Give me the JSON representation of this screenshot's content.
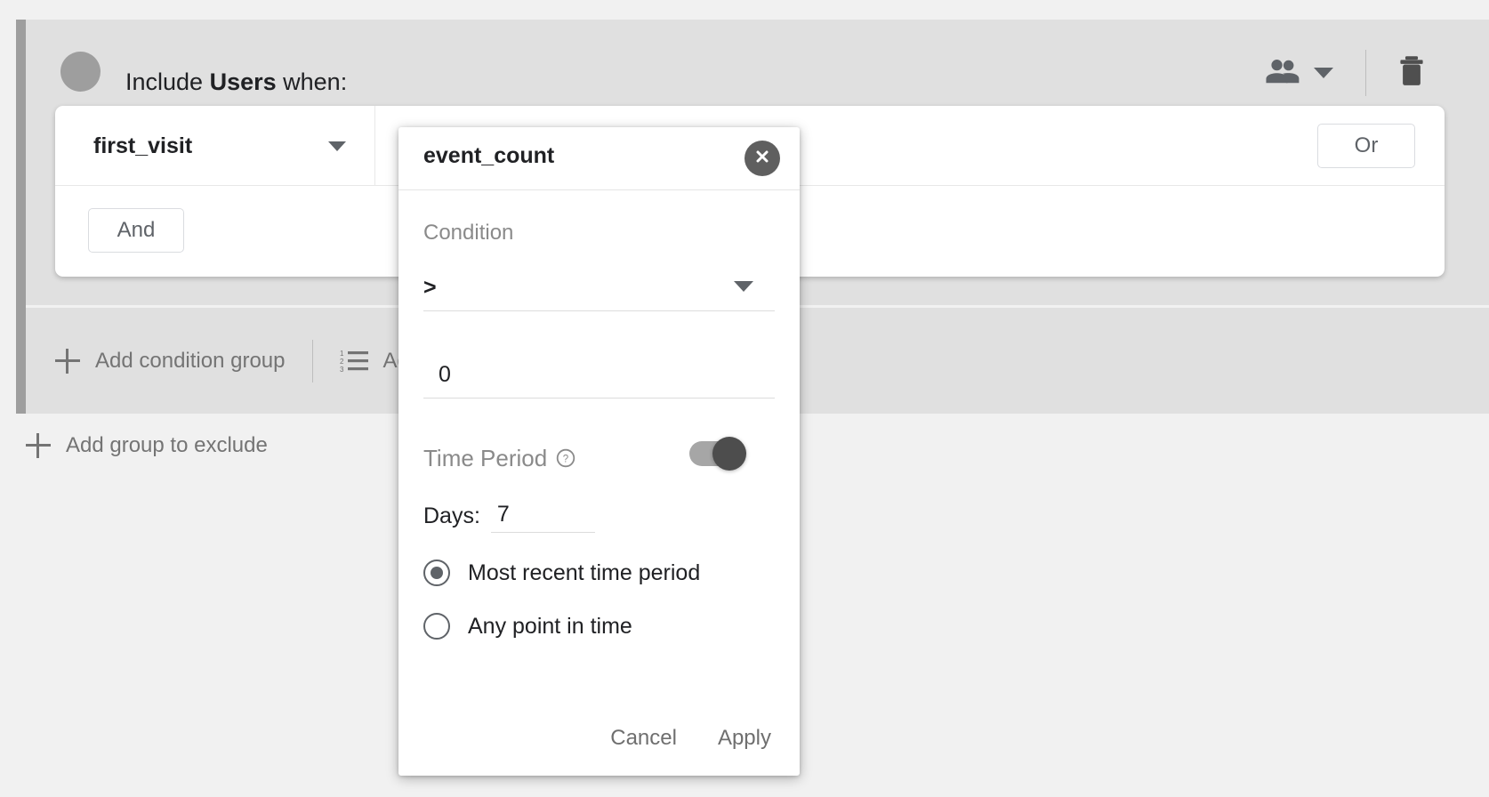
{
  "include_group": {
    "header": {
      "prefix": "Include ",
      "scope": "Users",
      "suffix": " when:",
      "audience_icon": "audience-dot-icon",
      "people_icon": "people-icon",
      "dropdown_icon": "chevron-down-icon",
      "delete_icon": "trash-icon"
    },
    "condition": {
      "dimension": "first_visit",
      "dimension_caret_icon": "chevron-down-icon",
      "or_label": "Or",
      "and_label": "And"
    },
    "footer": {
      "add_condition_group": "Add condition group",
      "add_condition_group_icon": "plus-icon",
      "sequence_icon": "numbered-list-icon",
      "sequence_label": "Add sequence"
    }
  },
  "exclude": {
    "label": "Add group to exclude",
    "icon": "plus-icon"
  },
  "popup": {
    "title": "event_count",
    "close_icon": "close-icon",
    "condition_label": "Condition",
    "operator": ">",
    "operator_caret_icon": "chevron-down-icon",
    "value": "0",
    "time_period_label": "Time Period",
    "help_icon": "help-circle-icon",
    "time_period_enabled": true,
    "days_label": "Days:",
    "days_value": "7",
    "radios": [
      {
        "label": "Most recent time period",
        "selected": true
      },
      {
        "label": "Any point in time",
        "selected": false
      }
    ],
    "cancel_label": "Cancel",
    "apply_label": "Apply"
  },
  "colors": {
    "page_bg": "#f1f1f1",
    "panel_bg": "#e0e0e0",
    "accent_bar": "#9e9e9e",
    "card_bg": "#ffffff",
    "text_primary": "#202124",
    "text_muted": "#747474",
    "toggle_track": "#a6a6a6",
    "toggle_thumb": "#4d4d4d",
    "close_bg": "#5f5f5f"
  }
}
